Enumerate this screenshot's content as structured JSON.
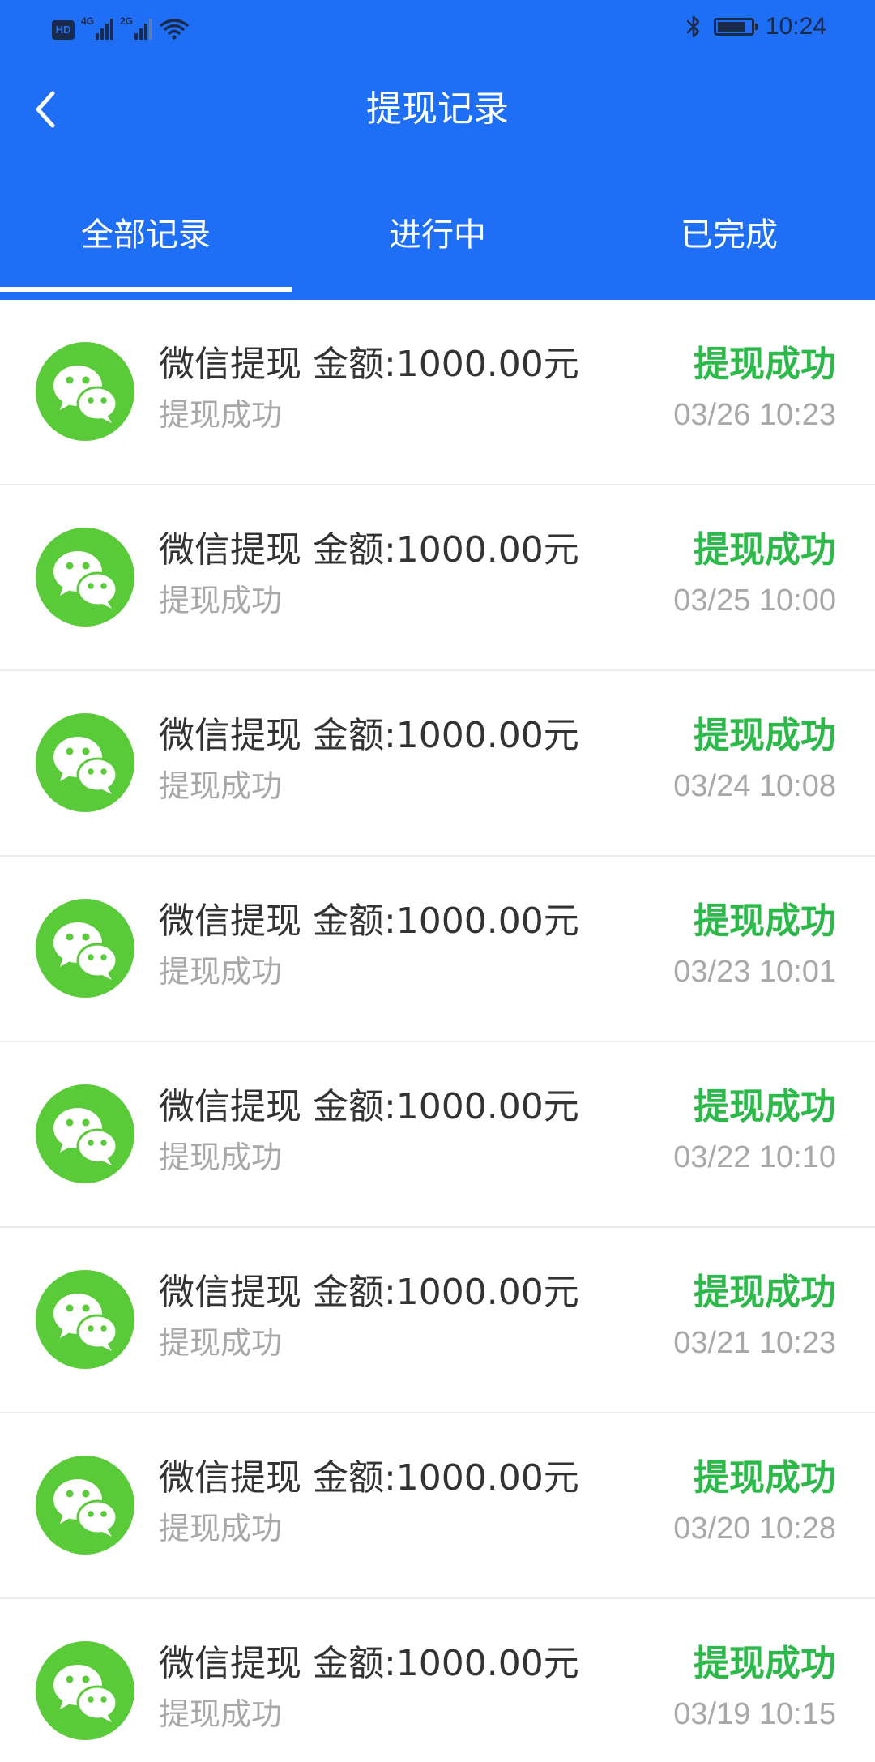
{
  "status_bar": {
    "hd": "HD",
    "signal1_label": "4G",
    "signal2_label": "2G",
    "time": "10:24"
  },
  "header": {
    "title": "提现记录"
  },
  "tabs": [
    {
      "label": "全部记录",
      "active": true
    },
    {
      "label": "进行中",
      "active": false
    },
    {
      "label": "已完成",
      "active": false
    }
  ],
  "colors": {
    "header_blue": "#1E6FF5",
    "wechat_green": "#5ACB38",
    "success_green": "#2DB84A"
  },
  "records": [
    {
      "title": "微信提现 金额:1000.00元",
      "subtitle": "提现成功",
      "status": "提现成功",
      "time": "03/26 10:23"
    },
    {
      "title": "微信提现 金额:1000.00元",
      "subtitle": "提现成功",
      "status": "提现成功",
      "time": "03/25 10:00"
    },
    {
      "title": "微信提现 金额:1000.00元",
      "subtitle": "提现成功",
      "status": "提现成功",
      "time": "03/24 10:08"
    },
    {
      "title": "微信提现 金额:1000.00元",
      "subtitle": "提现成功",
      "status": "提现成功",
      "time": "03/23 10:01"
    },
    {
      "title": "微信提现 金额:1000.00元",
      "subtitle": "提现成功",
      "status": "提现成功",
      "time": "03/22 10:10"
    },
    {
      "title": "微信提现 金额:1000.00元",
      "subtitle": "提现成功",
      "status": "提现成功",
      "time": "03/21 10:23"
    },
    {
      "title": "微信提现 金额:1000.00元",
      "subtitle": "提现成功",
      "status": "提现成功",
      "time": "03/20 10:28"
    },
    {
      "title": "微信提现 金额:1000.00元",
      "subtitle": "提现成功",
      "status": "提现成功",
      "time": "03/19 10:15"
    }
  ]
}
